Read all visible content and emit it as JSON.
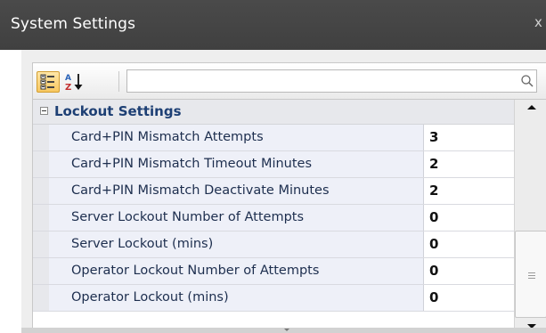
{
  "window": {
    "title": "System Settings",
    "close_glyph": "x"
  },
  "toolbar": {
    "categorized_icon": "categorized-view-icon",
    "alphabetical_icon": "sort-az-icon",
    "search_placeholder": "",
    "search_icon": "search-icon",
    "categorized_active": true
  },
  "category": {
    "label": "Lockout Settings",
    "expanded": true
  },
  "properties": [
    {
      "name": "Card+PIN Mismatch Attempts",
      "value": "3"
    },
    {
      "name": "Card+PIN Mismatch Timeout Minutes",
      "value": "2"
    },
    {
      "name": "Card+PIN Mismatch Deactivate Minutes",
      "value": "2"
    },
    {
      "name": "Server Lockout Number of Attempts",
      "value": "0"
    },
    {
      "name": "Server Lockout (mins)",
      "value": "0"
    },
    {
      "name": "Operator Lockout Number of Attempts",
      "value": "0"
    },
    {
      "name": "Operator Lockout (mins)",
      "value": "0"
    }
  ],
  "colors": {
    "titlebar": "#404040",
    "category_text": "#1d3f74",
    "name_column_bg": "#eef0f8",
    "active_toolbar_button": "#f7c860"
  }
}
